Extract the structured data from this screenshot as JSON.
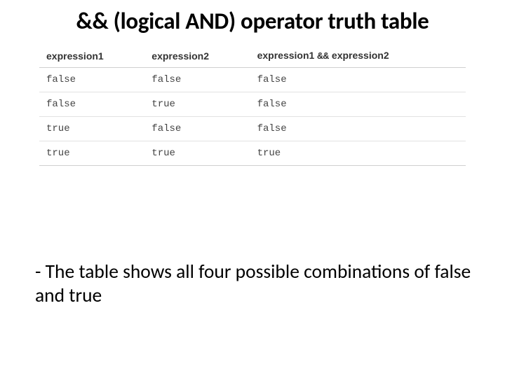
{
  "title": "&& (logical AND) operator truth table",
  "chart_data": {
    "type": "table",
    "headers": {
      "c1": "expression1",
      "c2": "expression2",
      "c3_a": "expression1",
      "c3_op": "&&",
      "c3_b": "expression2"
    },
    "rows": [
      {
        "c1": "false",
        "c2": "false",
        "c3": "false"
      },
      {
        "c1": "false",
        "c2": "true",
        "c3": "false"
      },
      {
        "c1": "true",
        "c2": "false",
        "c3": "false"
      },
      {
        "c1": "true",
        "c2": "true",
        "c3": "true"
      }
    ]
  },
  "caption": "- The table shows all four possible combinations of false and true"
}
